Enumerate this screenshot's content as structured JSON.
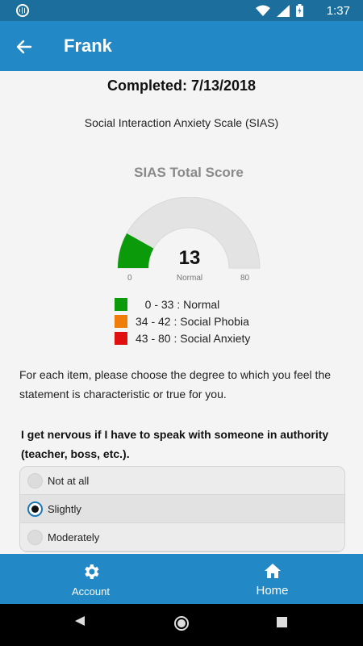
{
  "status_bar": {
    "time": "1:37"
  },
  "app_bar": {
    "title": "Frank"
  },
  "assessment": {
    "completed": "Completed: 7/13/2018",
    "scale_name": "Social Interaction Anxiety Scale (SIAS)"
  },
  "score": {
    "title": "SIAS Total Score",
    "value": "13",
    "score_numeric": 13,
    "category": "Normal",
    "min": "0",
    "max": "80",
    "min_numeric": 0,
    "max_numeric": 80
  },
  "legend": [
    {
      "label": "   0 - 33 : Normal",
      "color": "#0a9a0a"
    },
    {
      "label": "34 - 42 : Social Phobia",
      "color": "#f07d0a"
    },
    {
      "label": "43 - 80 : Social Anxiety",
      "color": "#e01010"
    }
  ],
  "instructions": "For each item, please choose the degree to which you feel the statement is characteristic or true for you.",
  "question": {
    "text": "I get nervous if I have to speak with someone in authority (teacher, boss, etc.).",
    "options": [
      {
        "label": "Not at all",
        "selected": false
      },
      {
        "label": "Slightly",
        "selected": true
      },
      {
        "label": "Moderately",
        "selected": false
      }
    ]
  },
  "bottom_nav": {
    "account_label": "Account",
    "home_label": "Home"
  },
  "colors": {
    "primary": "#2288c6",
    "status_bar": "#1c6f9c",
    "gauge_track": "#e3e3e3",
    "gauge_fill": "#0a9a0a"
  },
  "icons": {
    "back": "arrow-left-icon",
    "account": "gear-icon",
    "home": "home-icon"
  }
}
